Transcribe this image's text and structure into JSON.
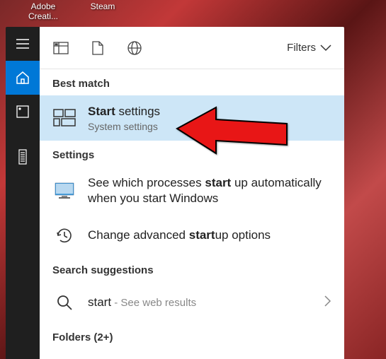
{
  "desktop": {
    "icon1": "Adobe Creati...",
    "icon2": "Steam"
  },
  "filters_label": "Filters",
  "sections": {
    "best_match": "Best match",
    "settings": "Settings",
    "search_suggestions": "Search suggestions",
    "folders": "Folders (2+)"
  },
  "results": {
    "item1_bold": "Start",
    "item1_rest": " settings",
    "item1_sub": "System settings",
    "item2_pre": "See which processes ",
    "item2_bold": "start",
    "item2_post": " up automatically when you start Windows",
    "item3_pre": "Change advanced ",
    "item3_bold": "start",
    "item3_post": "up options",
    "web_query": "start",
    "web_suffix": " - See web results"
  }
}
